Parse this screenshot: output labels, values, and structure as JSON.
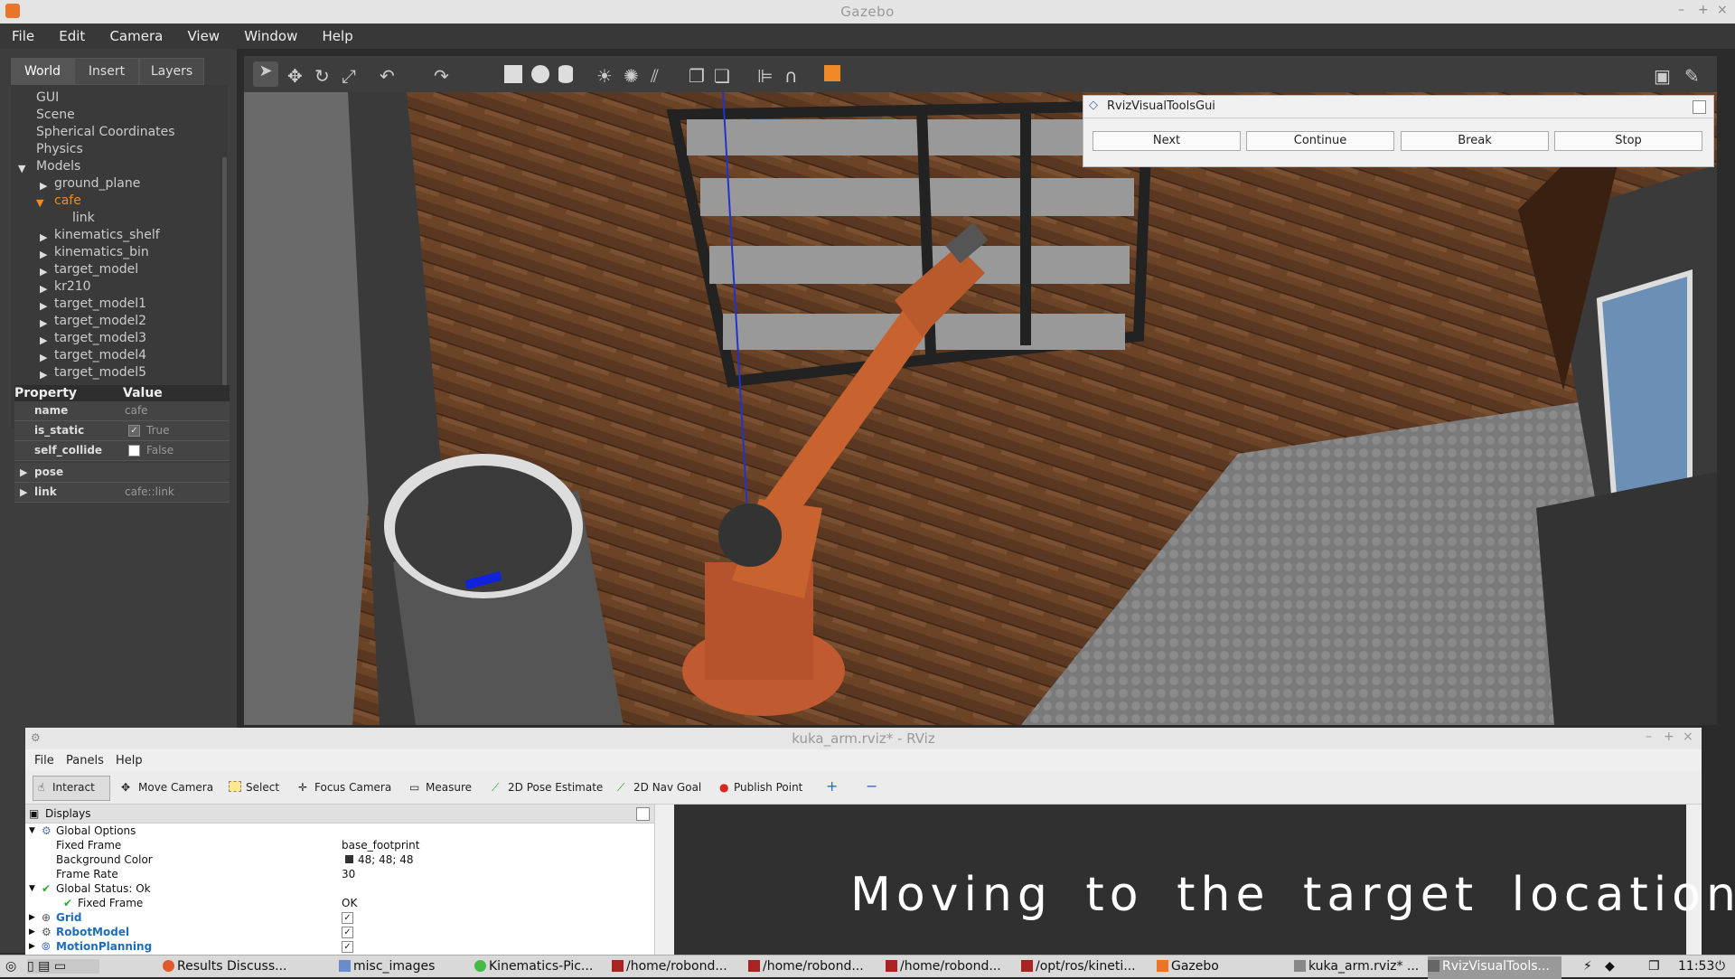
{
  "gazebo": {
    "title": "Gazebo",
    "menu": [
      "File",
      "Edit",
      "Camera",
      "View",
      "Window",
      "Help"
    ],
    "tabs": [
      "World",
      "Insert",
      "Layers"
    ],
    "tree": {
      "items": [
        "GUI",
        "Scene",
        "Spherical Coordinates",
        "Physics"
      ],
      "models_label": "Models",
      "models": [
        "ground_plane",
        "cafe",
        "link",
        "kinematics_shelf",
        "kinematics_bin",
        "target_model",
        "kr210",
        "target_model1",
        "target_model2",
        "target_model3",
        "target_model4",
        "target_model5"
      ],
      "selected": "cafe"
    },
    "properties": {
      "header_property": "Property",
      "header_value": "Value",
      "rows": [
        {
          "key": "name",
          "value": "cafe"
        },
        {
          "key": "is_static",
          "value": "True"
        },
        {
          "key": "self_collide",
          "value": "False"
        },
        {
          "key": "pose",
          "value": ""
        },
        {
          "key": "link",
          "value": "cafe::link"
        }
      ]
    }
  },
  "rviz_visual_tools": {
    "title": "RvizVisualToolsGui",
    "buttons": [
      "Next",
      "Continue",
      "Break",
      "Stop"
    ]
  },
  "rviz": {
    "title": "kuka_arm.rviz* - RViz",
    "menu": [
      "File",
      "Panels",
      "Help"
    ],
    "tools": [
      "Interact",
      "Move Camera",
      "Select",
      "Focus Camera",
      "Measure",
      "2D Pose Estimate",
      "2D Nav Goal",
      "Publish Point"
    ],
    "displays_title": "Displays",
    "displays": {
      "global_options": "Global Options",
      "fixed_frame_label": "Fixed Frame",
      "fixed_frame_value": "base_footprint",
      "bg_color_label": "Background Color",
      "bg_color_value": "48; 48; 48",
      "frame_rate_label": "Frame Rate",
      "frame_rate_value": "30",
      "global_status": "Global Status: Ok",
      "status_fixed_frame": "Fixed Frame",
      "status_value": "OK",
      "grid": "Grid",
      "robot_model": "RobotModel",
      "motion_planning": "MotionPlanning"
    },
    "overlay_text": "Moving  to  the  target  location"
  },
  "taskbar": {
    "items": [
      "Results Discuss...",
      "misc_images",
      "Kinematics-Pic...",
      "/home/robond...",
      "/home/robond...",
      "/home/robond...",
      "/opt/ros/kineti...",
      "Gazebo",
      "kuka_arm.rviz* ...",
      "RvizVisualTools..."
    ],
    "clock": "11:53"
  },
  "colors": {
    "accent": "#f08a24",
    "rviz_bg": "#303030"
  }
}
